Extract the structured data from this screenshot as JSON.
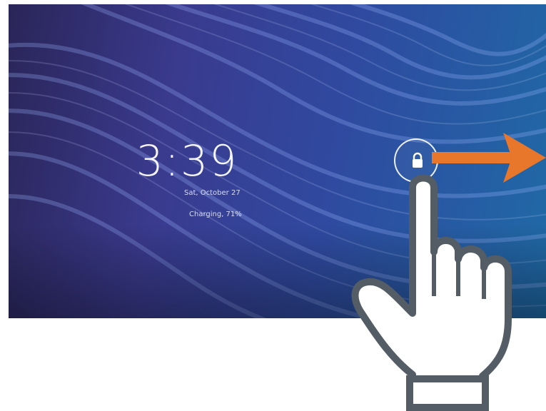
{
  "lockscreen": {
    "time": "3:39",
    "date": "Sat, October 27",
    "battery_status": "Charging, 71%"
  },
  "unlock": {
    "icon": "lock-icon",
    "direction_icon": "arrow-right-icon",
    "gesture_icon": "hand-pointer-icon"
  },
  "colors": {
    "arrow": "#e8762b",
    "hand_outline": "#545d66",
    "wallpaper_dark": "#2a2558",
    "wallpaper_light": "#1f6aa6"
  }
}
